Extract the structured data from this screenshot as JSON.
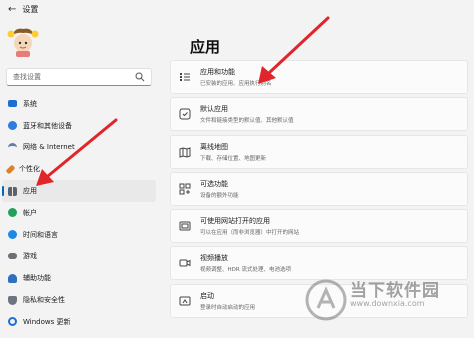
{
  "window": {
    "title": "设置"
  },
  "sidebar": {
    "search_placeholder": "查找设置",
    "items": [
      {
        "label": "系统",
        "icon": "display-icon",
        "color": "#1c6fd1"
      },
      {
        "label": "蓝牙和其他设备",
        "icon": "bluetooth-icon",
        "color": "#2b7de0"
      },
      {
        "label": "网络 & Internet",
        "icon": "wifi-icon",
        "color": "#5a7fa8"
      },
      {
        "label": "个性化",
        "icon": "brush-icon",
        "color": "#d9822b"
      },
      {
        "label": "应用",
        "icon": "apps-icon",
        "color": "#5a6270",
        "selected": true
      },
      {
        "label": "帐户",
        "icon": "person-icon",
        "color": "#25a05b"
      },
      {
        "label": "时间和语言",
        "icon": "globe-clock-icon",
        "color": "#1e88e5"
      },
      {
        "label": "游戏",
        "icon": "controller-icon",
        "color": "#6b6f76"
      },
      {
        "label": "辅助功能",
        "icon": "accessibility-icon",
        "color": "#2f6fbf"
      },
      {
        "label": "隐私和安全性",
        "icon": "shield-icon",
        "color": "#6d7680"
      },
      {
        "label": "Windows 更新",
        "icon": "update-icon",
        "color": "#1c6fd1"
      }
    ]
  },
  "main": {
    "title": "应用",
    "cards": [
      {
        "title": "应用和功能",
        "subtitle": "已安装的应用、应用执行别名",
        "icon": "apps-list-icon"
      },
      {
        "title": "默认应用",
        "subtitle": "文件和链接类型的默认值、其他默认值",
        "icon": "default-apps-icon"
      },
      {
        "title": "离线地图",
        "subtitle": "下载、存储位置、地图更新",
        "icon": "map-icon"
      },
      {
        "title": "可选功能",
        "subtitle": "设备的额外功能",
        "icon": "optional-features-icon"
      },
      {
        "title": "可使用网站打开的应用",
        "subtitle": "可以在应用（而非浏览器）中打开的网站",
        "icon": "web-apps-icon"
      },
      {
        "title": "视频播放",
        "subtitle": "视频调整、HDR 流式处理、电池选项",
        "icon": "video-icon"
      },
      {
        "title": "启动",
        "subtitle": "登录时自动启动的应用",
        "icon": "startup-icon"
      }
    ]
  },
  "watermark": {
    "text": "当下软件园",
    "url": "www.downxia.com"
  },
  "colors": {
    "accent": "#0067c0",
    "arrow": "#e0262a"
  }
}
